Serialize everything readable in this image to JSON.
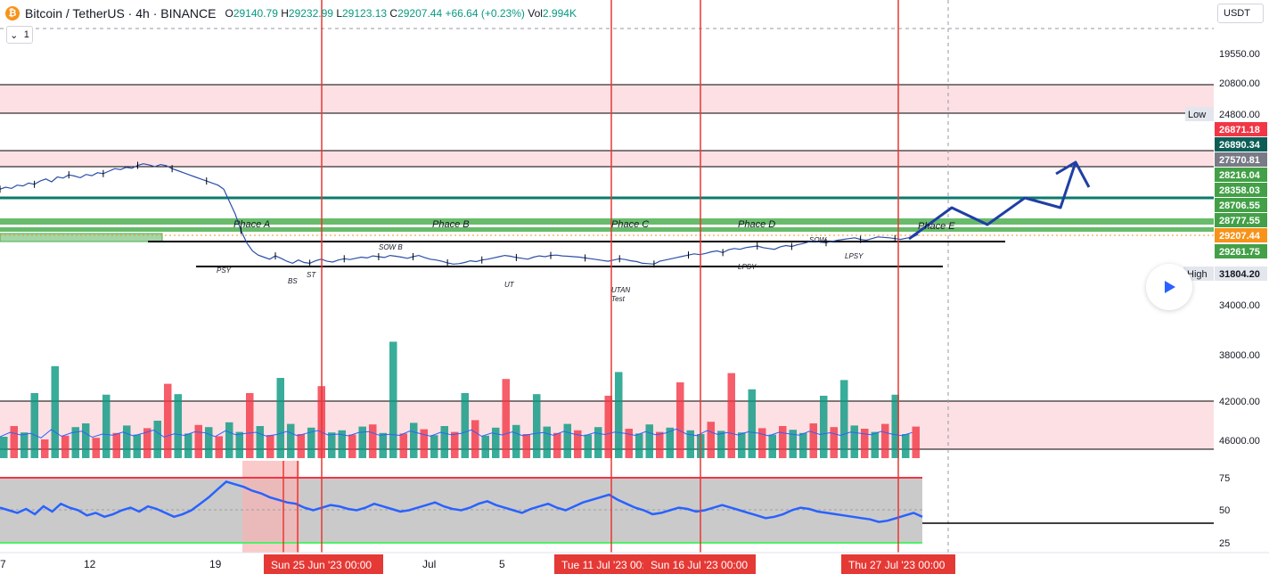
{
  "header": {
    "symbol": "Bitcoin / TetherUS · 4h · BINANCE",
    "open_label": "O",
    "open": "29140.79",
    "high_label": "H",
    "high": "29232.99",
    "low_label": "L",
    "low": "29123.13",
    "close_label": "C",
    "close": "29207.44",
    "change": "+66.64 (+0.23%)",
    "vol_label": "Vol",
    "vol": "2.994K",
    "indicator_count": "1",
    "currency": "USDT"
  },
  "colors": {
    "bull": "#089981",
    "bear": "#f23645",
    "price_line": "#2a4ea8",
    "zone": "#fde0e4",
    "green_zone": "#4caf50",
    "teal_line": "#0b7a6c",
    "red_vline": "#e53935",
    "arrow": "#1f3fa4",
    "rsi_band": "#c4c4c4"
  },
  "chart_data": {
    "type": "line",
    "title": "",
    "price_series": {
      "name": "",
      "y": [
        28800,
        28850,
        28820,
        28900,
        28880,
        28950,
        28920,
        29000,
        29050,
        28980,
        29100,
        29070,
        29150,
        29120,
        29080,
        29160,
        29130,
        29200,
        29180,
        29240,
        29300,
        29280,
        29330,
        29310,
        29380,
        29420,
        29390,
        29350,
        29400,
        29370,
        29300,
        29250,
        29200,
        29150,
        29100,
        29050,
        29000,
        28950,
        28900,
        28800,
        28500,
        28200,
        27800,
        27500,
        27300,
        27200,
        27150,
        27100,
        27180,
        27120,
        27050,
        27000,
        27080,
        27020,
        27000,
        27060,
        27100,
        27050,
        27030,
        27080,
        27110,
        27090,
        27120,
        27150,
        27130,
        27180,
        27160,
        27140,
        27190,
        27170,
        27150,
        27120,
        27160,
        27190,
        27140,
        27100,
        27080,
        27050,
        27010,
        26980,
        26990,
        27020,
        27060,
        27040,
        27080,
        27100,
        27130,
        27160,
        27190,
        27170,
        27140,
        27120,
        27100,
        27150,
        27180,
        27160,
        27190,
        27200,
        27180,
        27170,
        27160,
        27150,
        27130,
        27110,
        27090,
        27070,
        27050,
        27080,
        27110,
        27090,
        27060,
        27040,
        27000,
        26990,
        26980,
        27050,
        27080,
        27110,
        27140,
        27170,
        27200,
        27230,
        27210,
        27240,
        27280,
        27300,
        27260,
        27330,
        27360,
        27340,
        27380,
        27400,
        27420,
        27380,
        27360,
        27340,
        27400,
        27430,
        27410,
        27450,
        27480,
        27520,
        27540,
        27510,
        27500,
        27530,
        27560,
        27580,
        27600,
        27620,
        27580,
        27560,
        27600,
        27640,
        27630,
        27620,
        27600,
        27580,
        27610,
        27630,
        27700
      ]
    },
    "y_axis_ticks": [
      "19550.00",
      "20800.00",
      "24800.00",
      "34000.00",
      "38000.00",
      "42000.00",
      "46000.00"
    ],
    "price_labels": [
      {
        "text": "26871.18",
        "color": "#f23645"
      },
      {
        "text": "26890.34",
        "color": "#0b5e56"
      },
      {
        "text": "27570.81",
        "color": "#787b86"
      },
      {
        "text": "28216.04",
        "color": "#43a047"
      },
      {
        "text": "28358.03",
        "color": "#43a047"
      },
      {
        "text": "28706.55",
        "color": "#43a047"
      },
      {
        "text": "28777.55",
        "color": "#43a047"
      },
      {
        "text": "29207.44",
        "color": "#f7931a"
      },
      {
        "text": "29261.75",
        "color": "#43a047"
      },
      {
        "text": "31804.20",
        "color": "#e3e6ec"
      }
    ],
    "axis_side_labels": {
      "low": "Low",
      "high": "High"
    },
    "x_axis_ticks": [
      "7",
      "12",
      "19",
      "Jul",
      "5"
    ],
    "x_axis_highlights": [
      "Sun 25 Jun '23   00:00",
      "Tue 11 Jul '23   00:00",
      "Sun 16 Jul '23   00:00",
      "Thu 27 Jul '23   00:00"
    ],
    "annotations": [
      "Phace A",
      "Phace B",
      "Phace C",
      "Phace D",
      "Phace E",
      "PSY",
      "BS",
      "ST",
      "SOW B",
      "UT",
      "UTAN",
      "Test",
      "LPSY",
      "SOW",
      "LPSY"
    ],
    "rsi_ticks": [
      "75",
      "50",
      "25"
    ],
    "volume": {
      "values": [
        40,
        60,
        48,
        55,
        35,
        72,
        42,
        58,
        65,
        38,
        52,
        47,
        61,
        44,
        56,
        70,
        39,
        53,
        46,
        62,
        58,
        41,
        67,
        49,
        55,
        60,
        43,
        50,
        64,
        45,
        57,
        68,
        48,
        52,
        44,
        59,
        63,
        47,
        51,
        46,
        66,
        54,
        43,
        60,
        49,
        55,
        71,
        42,
        57,
        48,
        62,
        45,
        53,
        59,
        47,
        64,
        52,
        44,
        58,
        50,
        61,
        55,
        46,
        63,
        49,
        57,
        75,
        52,
        45,
        68,
        51,
        59,
        48,
        62,
        56,
        44,
        60,
        53,
        47,
        65,
        50,
        58,
        46,
        61,
        55,
        49,
        64,
        52,
        45,
        59
      ],
      "colors_cycle": [
        "bull",
        "bear",
        "bull",
        "bull",
        "bear",
        "bull",
        "bear",
        "bull",
        "bull",
        "bear"
      ]
    },
    "rsi": {
      "values": [
        52,
        50,
        48,
        51,
        47,
        53,
        49,
        55,
        52,
        50,
        46,
        48,
        45,
        47,
        50,
        52,
        49,
        53,
        51,
        48,
        45,
        47,
        50,
        55,
        60,
        66,
        72,
        70,
        68,
        65,
        63,
        60,
        58,
        56,
        55,
        52,
        50,
        52,
        54,
        53,
        51,
        50,
        52,
        55,
        53,
        51,
        49,
        50,
        52,
        54,
        56,
        53,
        51,
        50,
        52,
        55,
        57,
        54,
        52,
        50,
        48,
        51,
        53,
        55,
        52,
        50,
        53,
        56,
        58,
        60,
        62,
        58,
        55,
        52,
        50,
        47,
        48,
        50,
        52,
        51,
        49,
        50,
        52,
        54,
        52,
        50,
        48,
        46,
        44,
        45,
        47,
        50,
        52,
        51,
        49,
        48,
        47,
        46,
        45,
        44,
        43,
        41,
        42,
        44,
        46,
        48,
        45
      ]
    }
  }
}
